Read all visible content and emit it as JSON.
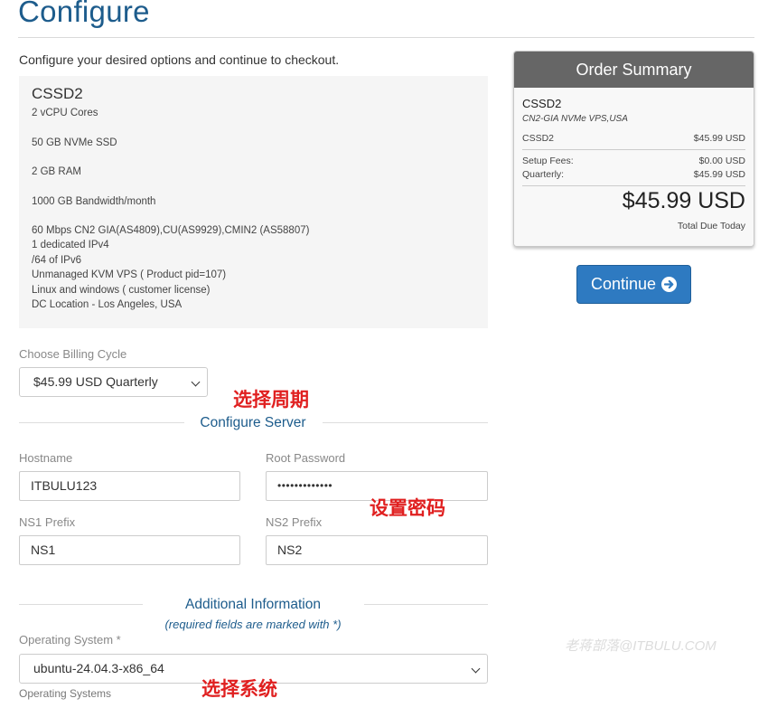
{
  "page": {
    "title": "Configure",
    "intro": "Configure your desired options and continue to checkout."
  },
  "product": {
    "name": "CSSD2",
    "features": [
      "2 vCPU Cores",
      "50 GB NVMe SSD",
      "2 GB RAM",
      "1000 GB Bandwidth/month",
      "60 Mbps CN2 GIA(AS4809),CU(AS9929),CMIN2 (AS58807)",
      "1 dedicated IPv4",
      "/64 of IPv6",
      "Unmanaged KVM VPS ( Product pid=107)",
      "Linux and windows ( customer license)",
      "DC Location - Los Angeles, USA"
    ]
  },
  "billing": {
    "label": "Choose Billing Cycle",
    "selected": "$45.99 USD Quarterly"
  },
  "configure_server": {
    "heading": "Configure Server",
    "hostname_label": "Hostname",
    "hostname_value": "ITBULU123",
    "password_label": "Root Password",
    "password_value": "•••••••••••••",
    "ns1_label": "NS1 Prefix",
    "ns1_value": "NS1",
    "ns2_label": "NS2 Prefix",
    "ns2_value": "NS2"
  },
  "additional": {
    "heading": "Additional Information",
    "required_note": "(required fields are marked with *)",
    "os_label": "Operating System *",
    "os_selected": "ubuntu-24.04.3-x86_64",
    "os_sublabel": "Operating Systems"
  },
  "annotations": {
    "billing": "选择周期",
    "password": "设置密码",
    "os": "选择系统"
  },
  "summary": {
    "heading": "Order Summary",
    "product_name": "CSSD2",
    "product_group": "CN2-GIA NVMe VPS,USA",
    "line_label": "CSSD2",
    "line_value": "$45.99 USD",
    "setup_label": "Setup Fees:",
    "setup_value": "$0.00 USD",
    "cycle_label": "Quarterly:",
    "cycle_value": "$45.99 USD",
    "total": "$45.99 USD",
    "total_label": "Total Due Today"
  },
  "continue_label": "Continue",
  "watermark": "老蒋部落@ITBULU.COM",
  "colors": {
    "brand_blue": "#1d5c8c",
    "button_blue": "#2e7ac1",
    "annotation_red": "#e02020",
    "summary_header": "#666666"
  },
  "icons": {
    "select_arrow": "chevron-down-icon",
    "continue_arrow": "arrow-circle-right-icon"
  }
}
